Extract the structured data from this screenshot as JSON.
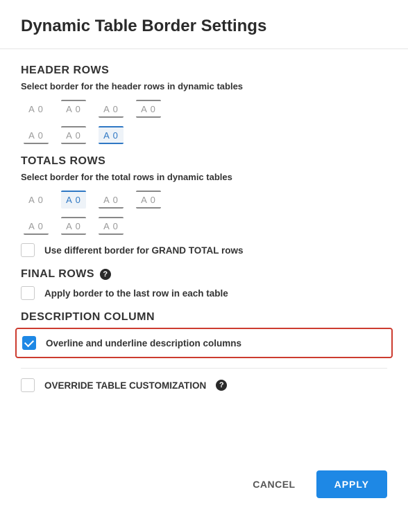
{
  "title": "Dynamic Table Border Settings",
  "header_rows": {
    "title": "HEADER ROWS",
    "desc": "Select border for the header rows in dynamic tables",
    "swatch_label": "A 0",
    "selected_index": 6
  },
  "totals_rows": {
    "title": "TOTALS ROWS",
    "desc": "Select border for the total rows in dynamic tables",
    "swatch_label": "A 0",
    "selected_index": 1,
    "grand_total_label": "Use different border for GRAND TOTAL rows",
    "grand_total_checked": false
  },
  "final_rows": {
    "title": "FINAL ROWS",
    "apply_label": "Apply border to the last row in each table",
    "apply_checked": false
  },
  "description_column": {
    "title": "DESCRIPTION COLUMN",
    "overline_label": "Overline and underline description columns",
    "overline_checked": true
  },
  "override": {
    "label": "OVERRIDE TABLE CUSTOMIZATION",
    "checked": false
  },
  "footer": {
    "cancel": "CANCEL",
    "apply": "APPLY"
  },
  "help_glyph": "?"
}
